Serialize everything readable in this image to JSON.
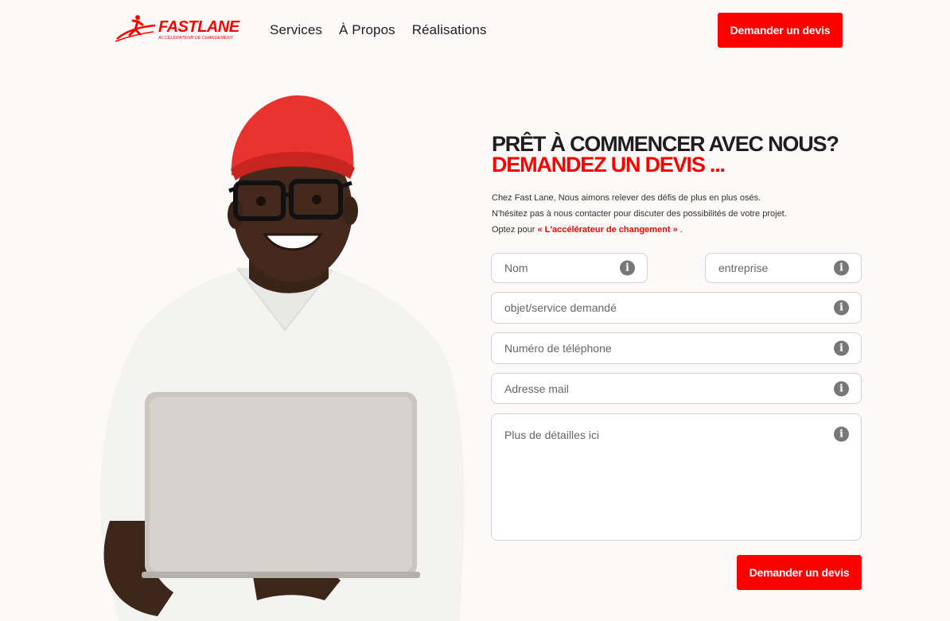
{
  "header": {
    "logo": {
      "brand": "FASTLANE",
      "tagline": "ACCÉLÉRATEUR DE CHANGEMENT"
    },
    "nav": [
      {
        "label": "Services"
      },
      {
        "label": "À Propos"
      },
      {
        "label": "Réalisations"
      }
    ],
    "cta_label": "Demander un devis"
  },
  "colors": {
    "accent": "#ff0000",
    "background": "#fdf9f8",
    "text": "#1e1e1e"
  },
  "hero": {
    "image": "smiling-man-red-cap-glasses-laptop"
  },
  "form_section": {
    "title_line1": "PRÊT À COMMENCER AVEC NOUS?",
    "title_line2": "DEMANDEZ UN DEVIS ...",
    "intro_line1": "Chez Fast Lane, Nous aimons relever des défis de plus en plus osés.",
    "intro_line2": "N'hésitez pas à nous contacter pour discuter des possibilités de votre projet.",
    "intro_line3_prefix": "Optez pour",
    "intro_highlight": "« L'accélérateur de changement »",
    "intro_line3_suffix": ".",
    "fields": {
      "nom": {
        "placeholder": "Nom",
        "icon": "info-icon"
      },
      "entreprise": {
        "placeholder": "entreprise",
        "icon": "info-icon"
      },
      "objet": {
        "placeholder": "objet/service demandé",
        "icon": "info-icon"
      },
      "telephone": {
        "placeholder": "Numéro de téléphone",
        "icon": "info-icon"
      },
      "email": {
        "placeholder": "Adresse mail",
        "icon": "info-icon"
      },
      "details": {
        "placeholder": "Plus de détailles ici",
        "icon": "info-icon"
      }
    },
    "submit_label": "Demander un devis",
    "info_glyph": "i"
  }
}
